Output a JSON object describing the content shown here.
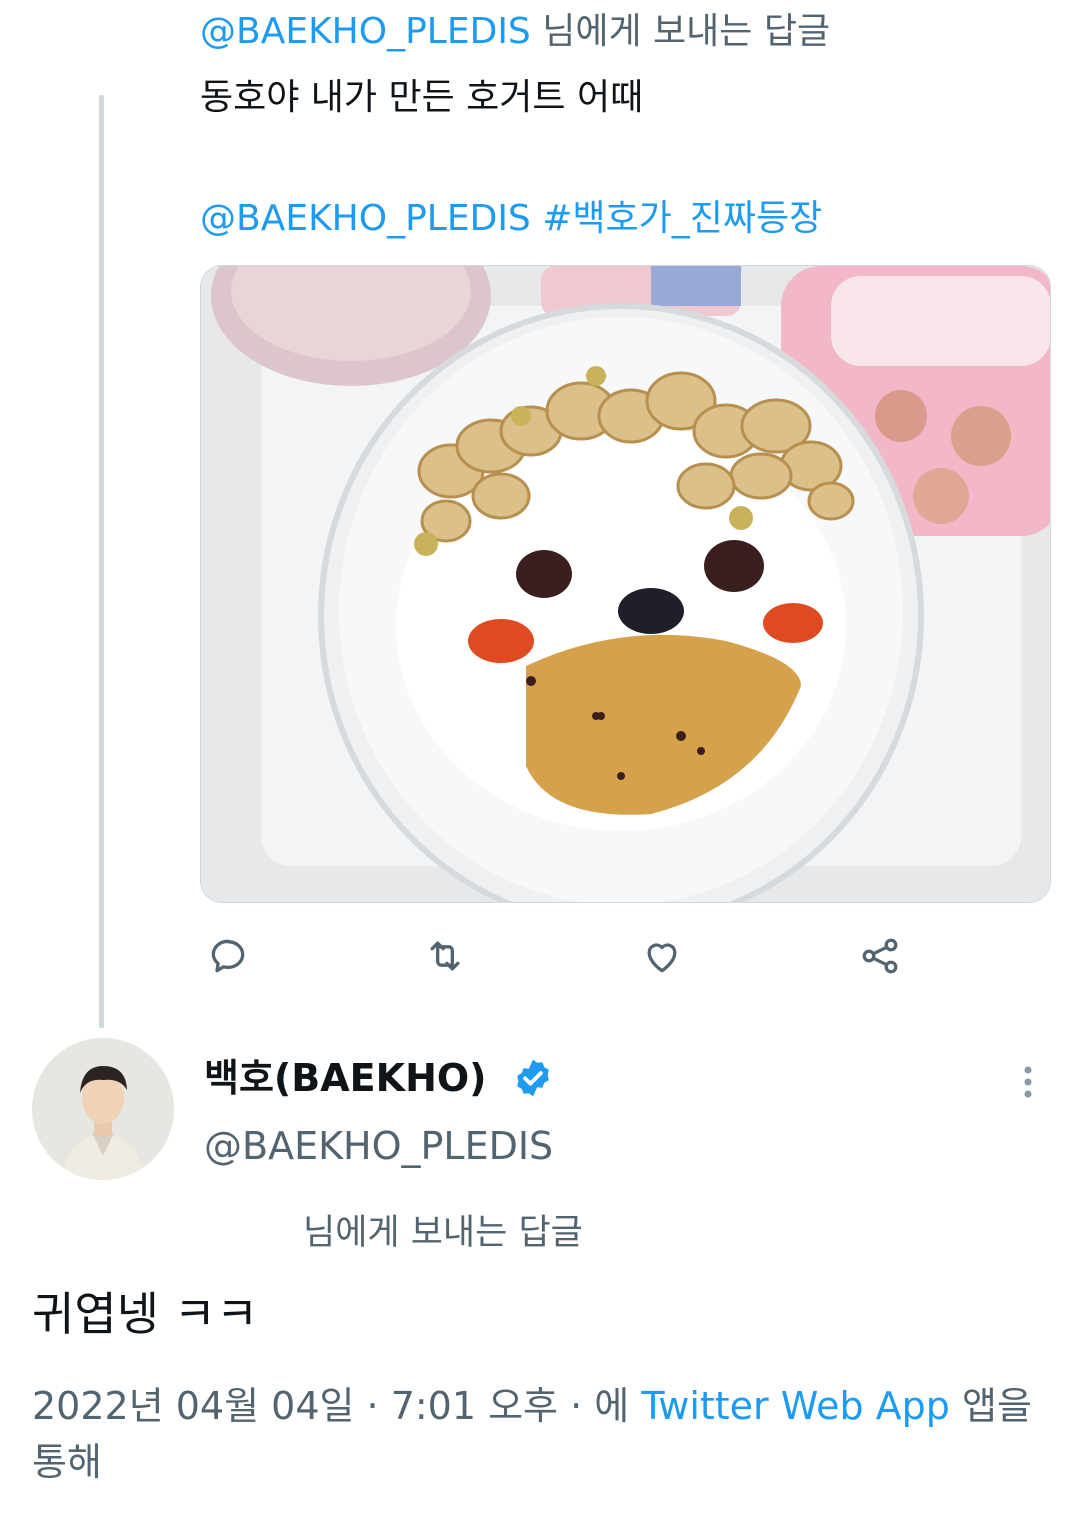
{
  "parent_tweet": {
    "reply_to_handle": "@BAEKHO_PLEDIS",
    "reply_to_suffix": " 님에게 보내는 답글",
    "text": "동호야 내가 만든 호거트 어때",
    "tag_mention": "@BAEKHO_PLEDIS",
    "hashtag": "#백호가_진짜등장",
    "media_alt": "yogurt decorated like a face with cereal hair, chocolate eyes and nose, and orange cheeks",
    "actions": {
      "reply_icon": "reply-icon",
      "retweet_icon": "retweet-icon",
      "like_icon": "heart-icon",
      "share_icon": "share-icon"
    }
  },
  "reply_tweet": {
    "display_name": "백호(BAEKHO)",
    "handle": "@BAEKHO_PLEDIS",
    "reply_to_label": "님에게 보내는 답글",
    "text": "귀엽넹 ㅋㅋ",
    "timestamp": "2022년 04월 04일 · 7:01 오후 · 에 ",
    "source": "Twitter Web App",
    "source_suffix": " 앱을 통해",
    "verified_icon": "verified-badge-icon",
    "more_icon": "more-options-icon"
  },
  "colors": {
    "link": "#1d9bf0",
    "secondary_text": "#536471",
    "primary_text": "#0f1419",
    "thread_line": "#cfd9de"
  }
}
